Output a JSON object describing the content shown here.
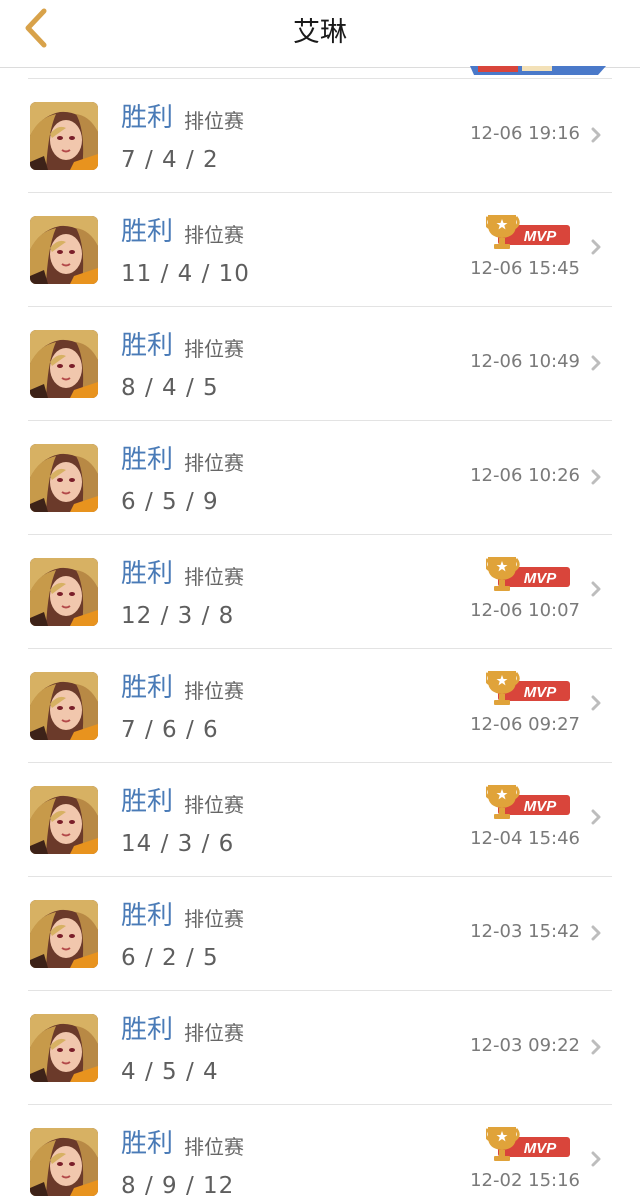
{
  "header": {
    "title": "艾琳"
  },
  "colors": {
    "accent_back": "#d8a24a",
    "result": "#4a7bb7",
    "mvp_red": "#d9453b",
    "trophy_gold": "#e0a33a"
  },
  "icons": {
    "back": "chevron-left-icon",
    "row_arrow": "chevron-right-icon",
    "mvp": "mvp-trophy-icon"
  },
  "mvp_label": "MVP",
  "matches": [
    {
      "result": "胜利",
      "mode": "排位赛",
      "kda": "7 / 4 / 2",
      "time": "12-06 19:16",
      "mvp": false
    },
    {
      "result": "胜利",
      "mode": "排位赛",
      "kda": "11 / 4 / 10",
      "time": "12-06 15:45",
      "mvp": true
    },
    {
      "result": "胜利",
      "mode": "排位赛",
      "kda": "8 / 4 / 5",
      "time": "12-06 10:49",
      "mvp": false
    },
    {
      "result": "胜利",
      "mode": "排位赛",
      "kda": "6 / 5 / 9",
      "time": "12-06 10:26",
      "mvp": false
    },
    {
      "result": "胜利",
      "mode": "排位赛",
      "kda": "12 / 3 / 8",
      "time": "12-06 10:07",
      "mvp": true
    },
    {
      "result": "胜利",
      "mode": "排位赛",
      "kda": "7 / 6 / 6",
      "time": "12-06 09:27",
      "mvp": true
    },
    {
      "result": "胜利",
      "mode": "排位赛",
      "kda": "14 / 3 / 6",
      "time": "12-04 15:46",
      "mvp": true
    },
    {
      "result": "胜利",
      "mode": "排位赛",
      "kda": "6 / 2 / 5",
      "time": "12-03 15:42",
      "mvp": false
    },
    {
      "result": "胜利",
      "mode": "排位赛",
      "kda": "4 / 5 / 4",
      "time": "12-03 09:22",
      "mvp": false
    },
    {
      "result": "胜利",
      "mode": "排位赛",
      "kda": "8 / 9 / 12",
      "time": "12-02 15:16",
      "mvp": true
    }
  ]
}
